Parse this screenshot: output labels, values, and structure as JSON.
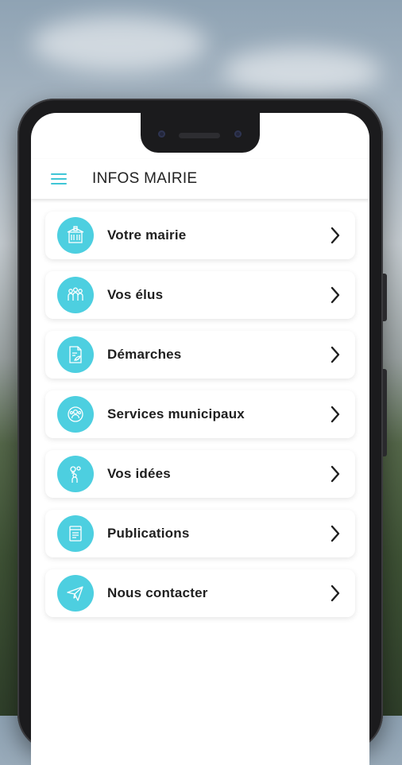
{
  "appbar": {
    "title": "INFOS MAIRIE"
  },
  "menu": {
    "items": [
      {
        "label": "Votre mairie",
        "icon": "town-hall-icon"
      },
      {
        "label": "Vos élus",
        "icon": "people-icon"
      },
      {
        "label": "Démarches",
        "icon": "document-icon"
      },
      {
        "label": "Services municipaux",
        "icon": "services-icon"
      },
      {
        "label": "Vos idées",
        "icon": "ideas-icon"
      },
      {
        "label": "Publications",
        "icon": "publication-icon"
      },
      {
        "label": "Nous contacter",
        "icon": "paper-plane-icon"
      }
    ]
  },
  "colors": {
    "accent": "#4dcfe0",
    "menu_icon": "#3fc6d6",
    "text": "#1f1f1f"
  }
}
